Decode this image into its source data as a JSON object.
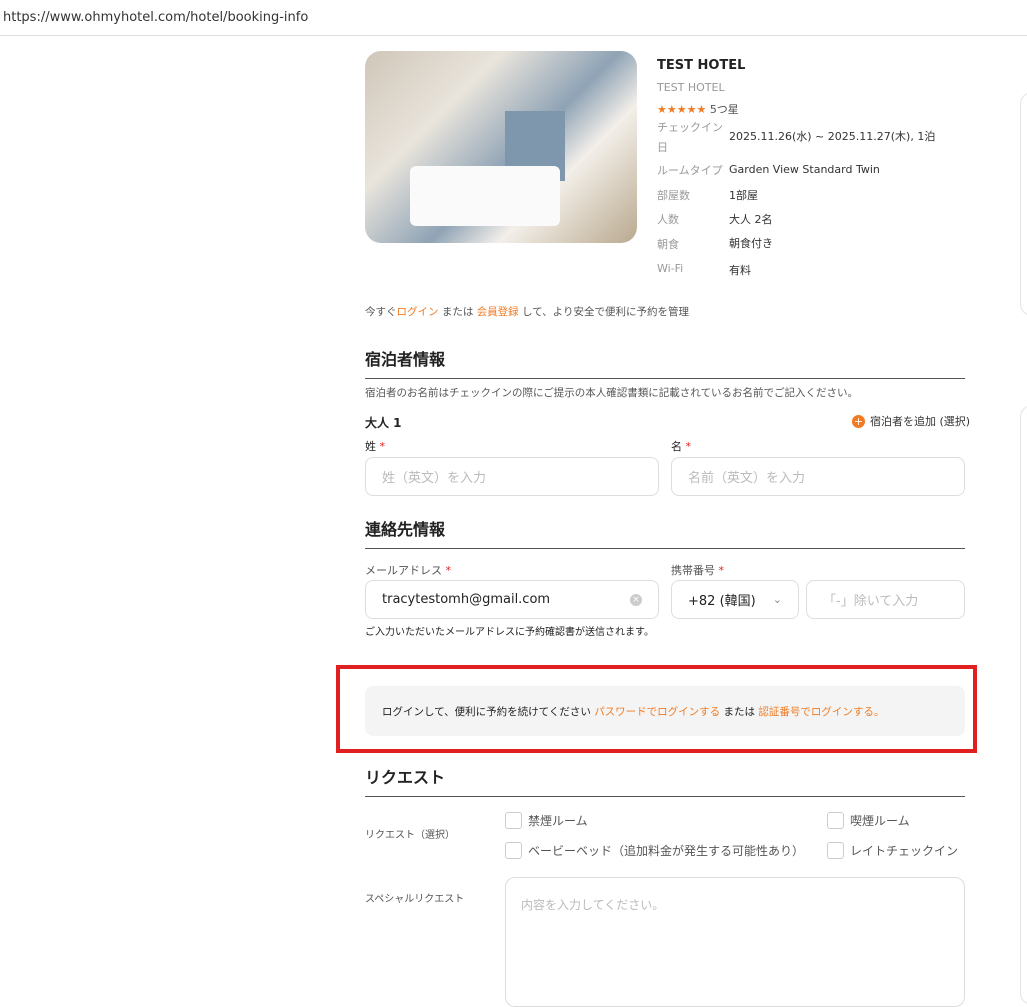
{
  "browser": {
    "url": "https://www.ohmyhotel.com/hotel/booking-info"
  },
  "hotel": {
    "name": "TEST HOTEL",
    "subname": "TEST HOTEL",
    "stars": "★★★★★",
    "star_label": "5つ星",
    "details": [
      {
        "label": "チェックイン日",
        "value": "2025.11.26(水) ~ 2025.11.27(木), 1泊"
      },
      {
        "label": "ルームタイプ",
        "value": "Garden View Standard Twin"
      },
      {
        "label": "部屋数",
        "value": "1部屋"
      },
      {
        "label": "人数",
        "value": "大人 2名"
      },
      {
        "label": "朝食",
        "value": "朝食付き"
      },
      {
        "label": "Wi-Fi",
        "value": "有料"
      }
    ]
  },
  "login_prompt": {
    "prefix": "今すぐ",
    "login": "ログイン",
    "or": " または ",
    "signup": "会員登録",
    "suffix": " して、より安全で便利に予約を管理"
  },
  "guest": {
    "title": "宿泊者情報",
    "note": "宿泊者のお名前はチェックインの際にご提示の本人確認書類に記載されているお名前でご記入ください。",
    "adult": "大人 1",
    "add": "宿泊者を追加 (選択)",
    "last_label": "姓",
    "last_ph": "姓（英文）を入力",
    "first_label": "名",
    "first_ph": "名前（英文）を入力"
  },
  "contact": {
    "title": "連絡先情報",
    "email_label": "メールアドレス",
    "email_value": "tracytestomh@gmail.com",
    "phone_label": "携帯番号",
    "country": "+82 (韓国)",
    "phone_ph": "「-」除いて入力",
    "note": "ご入力いただいたメールアドレスに予約確認書が送信されます。"
  },
  "login_box": {
    "text": "ログインして、便利に予約を続けてください ",
    "password_link": "パスワードでログインする",
    "or": " または ",
    "code_link": "認証番号でログインする。"
  },
  "request": {
    "title": "リクエスト",
    "label": "リクエスト（選択）",
    "options": [
      "禁煙ルーム",
      "喫煙ルーム",
      "ベービーベッド（追加料金が発生する可能性あり）",
      "レイトチェックイン"
    ],
    "special_label": "スペシャルリクエスト",
    "special_ph": "内容を入力してください。"
  },
  "colors": {
    "accent": "#f07b22",
    "highlight": "#e02020"
  }
}
